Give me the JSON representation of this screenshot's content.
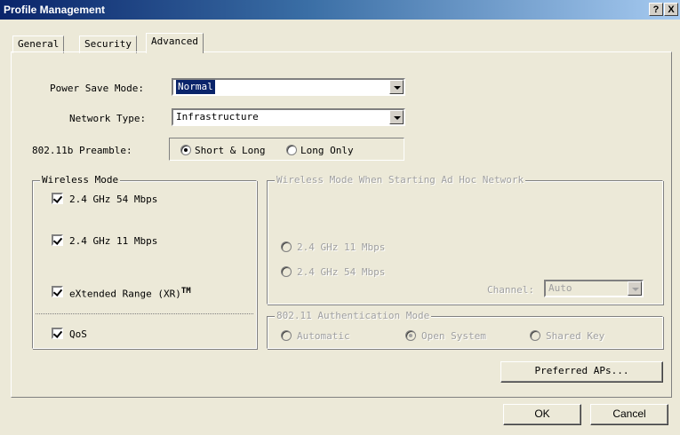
{
  "window": {
    "title": "Profile Management",
    "help_button": "?",
    "close_button": "X"
  },
  "tabs": [
    {
      "label": "General"
    },
    {
      "label": "Security"
    },
    {
      "label": "Advanced",
      "active": true
    }
  ],
  "fields": {
    "power_save_mode": {
      "label": "Power Save Mode:",
      "value": "Normal"
    },
    "network_type": {
      "label": "Network Type:",
      "value": "Infrastructure"
    },
    "preamble": {
      "label": "802.11b Preamble:",
      "options": [
        "Short & Long",
        "Long Only"
      ],
      "selected": "Short & Long"
    }
  },
  "wireless_mode": {
    "title": "Wireless Mode",
    "options": [
      {
        "label": "2.4 GHz 54 Mbps",
        "checked": true
      },
      {
        "label": "2.4 GHz 11 Mbps",
        "checked": true
      },
      {
        "label": "eXtended Range (XR)",
        "superscript": "TM",
        "checked": true
      },
      {
        "label": "QoS",
        "checked": true
      }
    ]
  },
  "adhoc_mode": {
    "title": "Wireless Mode When Starting Ad Hoc Network",
    "options": [
      "2.4 GHz 11 Mbps",
      "2.4 GHz 54 Mbps"
    ],
    "channel_label": "Channel:",
    "channel_value": "Auto"
  },
  "auth_mode": {
    "title": "802.11 Authentication Mode",
    "options": [
      "Automatic",
      "Open System",
      "Shared Key"
    ],
    "selected": "Open System"
  },
  "buttons": {
    "preferred_aps": "Preferred APs...",
    "ok": "OK",
    "cancel": "Cancel"
  },
  "colors": {
    "titlebar": "#0a246a",
    "dialog_bg": "#ece9d8",
    "selection": "#0a246a"
  }
}
